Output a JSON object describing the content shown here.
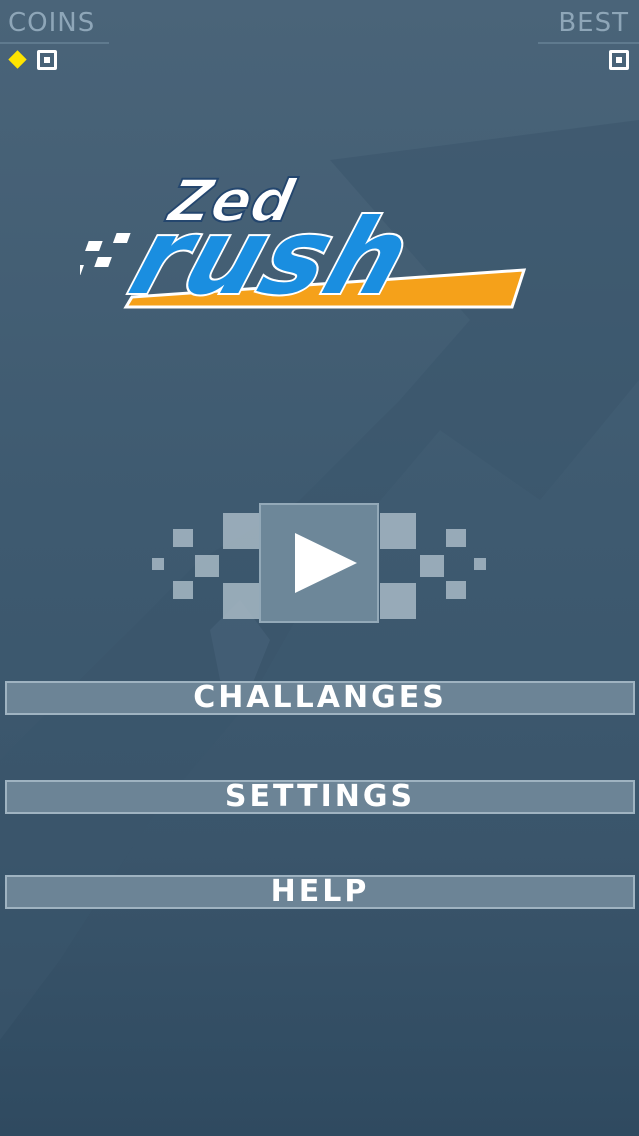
{
  "hud": {
    "coins_label": "COINS",
    "coins_value": "0",
    "best_label": "BEST",
    "best_value": "0",
    "coin_icon": "yellow-diamond-icon"
  },
  "logo": {
    "line1": "Zed",
    "line2": "rush"
  },
  "play": {
    "icon": "play-triangle-icon"
  },
  "menu": {
    "challenges_label": "CHALLANGES",
    "settings_label": "SETTINGS",
    "help_label": "HELP"
  },
  "colors": {
    "background": "#3e5a70",
    "button_fill": "#6c8496",
    "button_border": "#9fb3c1",
    "logo_blue": "#1a8ee0",
    "logo_orange": "#f5a11a",
    "coin_yellow": "#ffe400"
  }
}
